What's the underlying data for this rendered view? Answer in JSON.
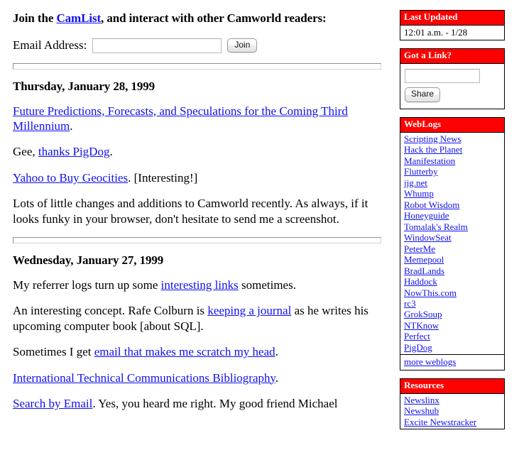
{
  "signup": {
    "heading_before": "Join the ",
    "heading_link": "CamList",
    "heading_after": ", and interact with other Camworld readers:",
    "email_label": "Email Address:",
    "email_value": "",
    "email_placeholder": "",
    "join_button": "Join"
  },
  "entries": [
    {
      "date": "Thursday, January 28, 1999",
      "paragraphs": [
        {
          "pre": "",
          "link": "Future Predictions, Forecasts, and Speculations for the Coming Third Millennium",
          "post": "."
        },
        {
          "pre": "Gee, ",
          "link": "thanks PigDog",
          "post": "."
        },
        {
          "pre": "",
          "link": "Yahoo to Buy Geocities",
          "post": ". [Interesting!]"
        },
        {
          "pre": "Lots of little changes and additions to Camworld recently. As always, if it looks funky in your browser, don't hesitate to send me a screenshot.",
          "link": "",
          "post": ""
        }
      ]
    },
    {
      "date": "Wednesday, January 27, 1999",
      "paragraphs": [
        {
          "pre": "My referrer logs turn up some ",
          "link": "interesting links",
          "post": " sometimes."
        },
        {
          "pre": "An interesting concept. Rafe Colburn is ",
          "link": "keeping a journal",
          "post": " as he writes his upcoming computer book [about SQL]."
        },
        {
          "pre": "Sometimes I get ",
          "link": "email that makes me scratch my head",
          "post": "."
        },
        {
          "pre": "",
          "link": "International Technical Communications Bibliography",
          "post": "."
        },
        {
          "pre": "",
          "link": "Search by Email",
          "post": ". Yes, you heard me right. My good friend Michael"
        }
      ]
    }
  ],
  "sidebar": {
    "last_updated": {
      "title": "Last Updated",
      "value": "12:01 a.m. - 1/28"
    },
    "got_a_link": {
      "title": "Got a Link?",
      "input_value": "",
      "input_placeholder": "",
      "share_button": "Share"
    },
    "weblogs": {
      "title": "WebLogs",
      "links": [
        "Scripting News",
        "Hack the Planet",
        "Manifestation",
        "Flutterby",
        "jjg.net",
        "Whump",
        "Robot Wisdom",
        "Honeyguide",
        "Tomalak's Realm",
        "WindowSeat",
        "PeterMe",
        "Memepool",
        "BradLands",
        "Haddock",
        "NowThis.com",
        "rc3",
        "GrokSoup",
        "NTKnow",
        "Perfect",
        "PigDog"
      ],
      "more_link": "more weblogs"
    },
    "resources": {
      "title": "Resources",
      "links": [
        "Newslinx",
        "Newshub",
        "Excite Newstracker"
      ]
    }
  },
  "colors": {
    "panel_header_bg": "#ff0000",
    "panel_header_fg": "#ffffff",
    "link": "#1010ee",
    "page_bg": "#ffffff",
    "text": "#000000"
  }
}
